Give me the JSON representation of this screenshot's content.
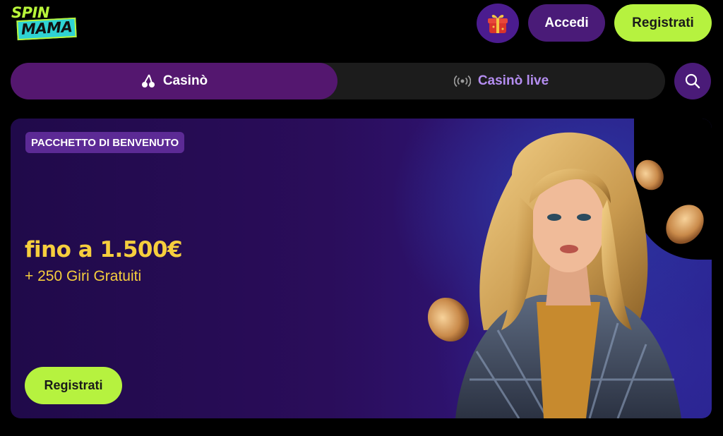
{
  "header": {
    "logo_line1": "SPIN",
    "logo_line2": "MAMA",
    "gift_icon": "gift-icon",
    "login_label": "Accedi",
    "register_label": "Registrati"
  },
  "tabs": [
    {
      "label": "Casinò",
      "icon": "cherry-icon",
      "active": true
    },
    {
      "label": "Casinò live",
      "icon": "live-broadcast-icon",
      "active": false
    }
  ],
  "search_icon": "search-icon",
  "banner": {
    "badge": "PACCHETTO DI BENVENUTO",
    "offer_main": "fino a 1.500€",
    "offer_sub": "+ 250 Giri Gratuiti",
    "cta_label": "Registrati",
    "image": "woman-with-coins-illustration"
  },
  "colors": {
    "accent_green": "#b6f23f",
    "purple_button": "#4a1b78",
    "active_tab": "#54176f",
    "offer_gold": "#f6ce3d",
    "live_tab_text": "#b48df0"
  }
}
